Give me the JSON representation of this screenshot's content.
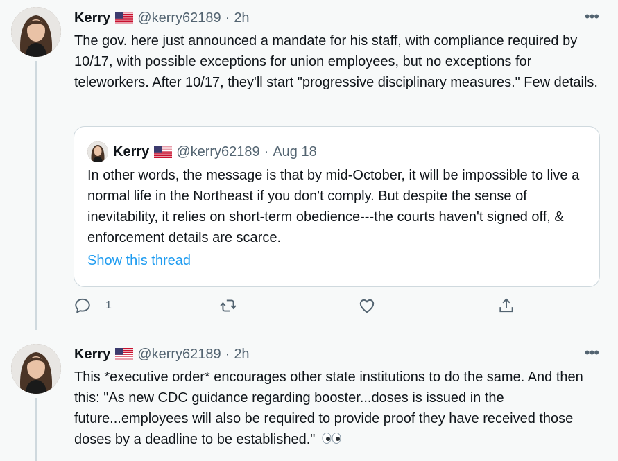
{
  "tweets": [
    {
      "author_name": "Kerry",
      "handle": "@kerry62189",
      "separator": "·",
      "time": "2h",
      "more_label": "•••",
      "text": "The gov. here just announced a mandate for his staff, with compliance required by 10/17, with possible exceptions for union employees, but no exceptions for teleworkers. After 10/17, they'll start \"progressive disciplinary measures.\" Few details.",
      "quoted": {
        "author_name": "Kerry",
        "handle": "@kerry62189",
        "separator": "·",
        "date": "Aug 18",
        "text": "In other words, the message is that by mid-October, it will be impossible to live a normal life in the Northeast if you don't comply. But despite the sense of inevitability, it relies on short-term obedience---the courts haven't signed off, & enforcement details are scarce.",
        "link_label": "Show this thread"
      },
      "actions": {
        "reply_count": "1",
        "reply_icon": "reply-icon",
        "retweet_icon": "retweet-icon",
        "like_icon": "heart-icon",
        "share_icon": "share-icon"
      }
    },
    {
      "author_name": "Kerry",
      "handle": "@kerry62189",
      "separator": "·",
      "time": "2h",
      "more_label": "•••",
      "text": "This *executive order* encourages other state institutions to do the same. And then this: \"As new CDC guidance regarding booster...doses is issued in the future...employees will also be required to provide proof they have received those doses by a deadline to be established.\"",
      "emoji_icon": "eyes-icon"
    }
  ],
  "colors": {
    "text_primary": "#0f1419",
    "text_secondary": "#536471",
    "link": "#1d9bf0",
    "border": "#cfd9de"
  }
}
